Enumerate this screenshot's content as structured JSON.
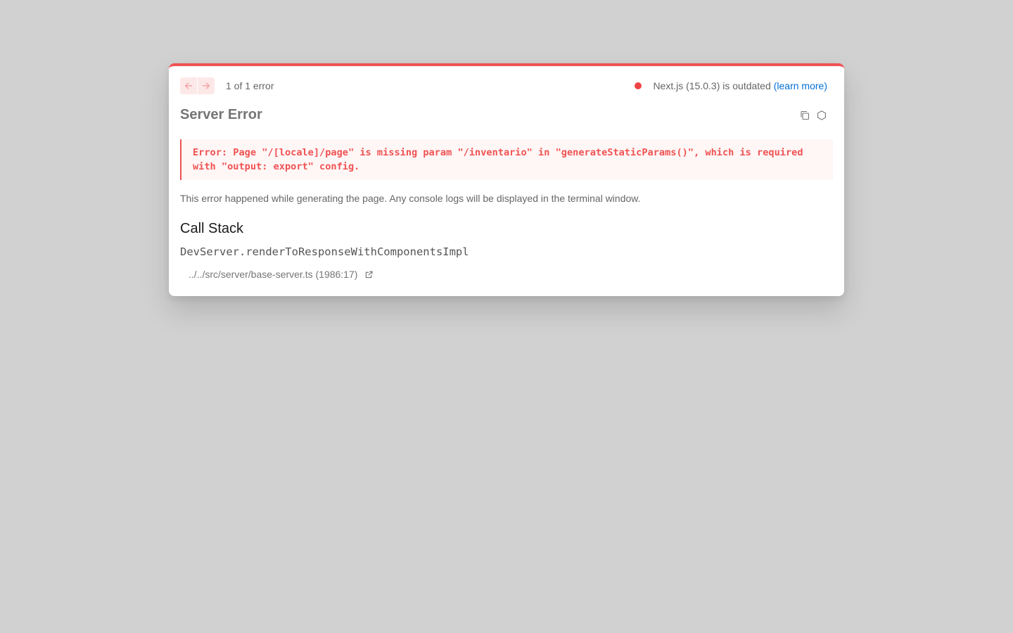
{
  "nav": {
    "prev_icon": "arrow-left-icon",
    "next_icon": "arrow-right-icon",
    "count_label": "1 of 1 error"
  },
  "version": {
    "status_color": "#f04444",
    "text": "Next.js (15.0.3) is outdated",
    "link_label": "(learn more)"
  },
  "error": {
    "title": "Server Error",
    "copy_icon": "copy-icon",
    "nodejs_icon": "nodejs-icon",
    "message": "Error: Page \"/[locale]/page\" is missing param \"/inventario\" in \"generateStaticParams()\", which is required with \"output: export\" config.",
    "description": "This error happened while generating the page. Any console logs will be displayed in the terminal window."
  },
  "call_stack": {
    "heading": "Call Stack",
    "frames": [
      {
        "function": "DevServer.renderToResponseWithComponentsImpl",
        "location": "../../src/server/base-server.ts (1986:17)",
        "open_icon": "external-link-icon"
      }
    ]
  },
  "colors": {
    "accent": "#f05252",
    "link": "#0070d9",
    "backdrop": "#d1d1d1"
  }
}
